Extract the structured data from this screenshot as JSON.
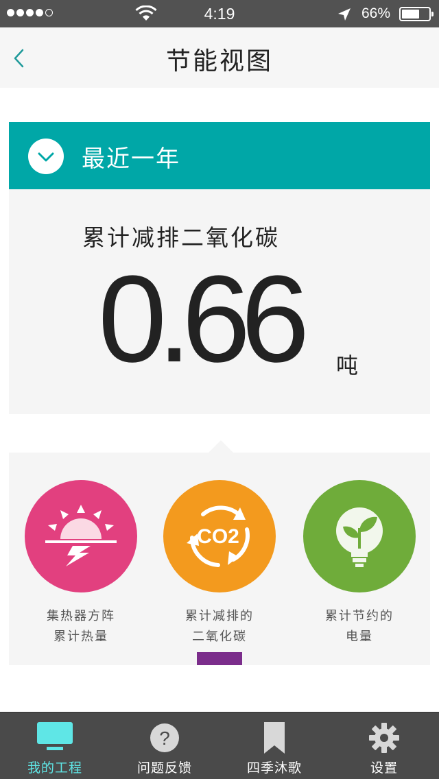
{
  "status": {
    "time": "4:19",
    "battery": "66%",
    "battery_level": 0.66
  },
  "nav": {
    "title": "节能视图",
    "back_icon": "chevron-left-icon"
  },
  "range": {
    "label": "最近一年",
    "icon": "chevron-down-icon"
  },
  "stat": {
    "label": "累计减排二氧化碳",
    "value": "0.66",
    "unit": "吨"
  },
  "categories": [
    {
      "line1": "集热器方阵",
      "line2": "累计热量",
      "color": "#e2407f",
      "icon": "sunrise-icon"
    },
    {
      "line1": "累计减排的",
      "line2": "二氧化碳",
      "color": "#f39a1e",
      "icon": "co2-cycle-icon",
      "icon_text": "CO2",
      "selected": true
    },
    {
      "line1": "累计节约的",
      "line2": "电量",
      "color": "#6fac3a",
      "icon": "eco-bulb-icon"
    }
  ],
  "tabs": [
    {
      "label": "我的工程",
      "icon": "monitor-icon",
      "active": true
    },
    {
      "label": "问题反馈",
      "icon": "question-icon"
    },
    {
      "label": "四季沐歌",
      "icon": "bookmark-icon"
    },
    {
      "label": "设置",
      "icon": "gear-icon"
    }
  ],
  "colors": {
    "teal": "#00a7a7",
    "active_tab": "#5fe6e6",
    "indicator": "#7b2d8b",
    "tabbar": "#4a4a4a"
  }
}
